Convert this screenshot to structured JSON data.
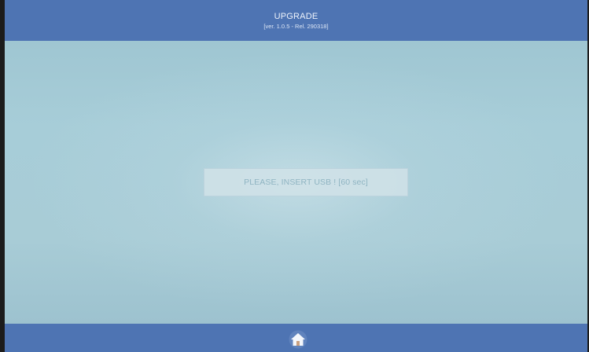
{
  "header": {
    "title": "UPGRADE",
    "subtitle": "[ver. 1.0.5 - Rel. 290318]"
  },
  "main": {
    "message": "PLEASE, INSERT USB ! [60 sec]"
  },
  "footer": {
    "home_icon": "home-icon"
  },
  "colors": {
    "bar": "#4e74b3",
    "background": "#a9ccd6",
    "message_box": "#d0e2e8",
    "message_text": "#8fb4c2"
  }
}
